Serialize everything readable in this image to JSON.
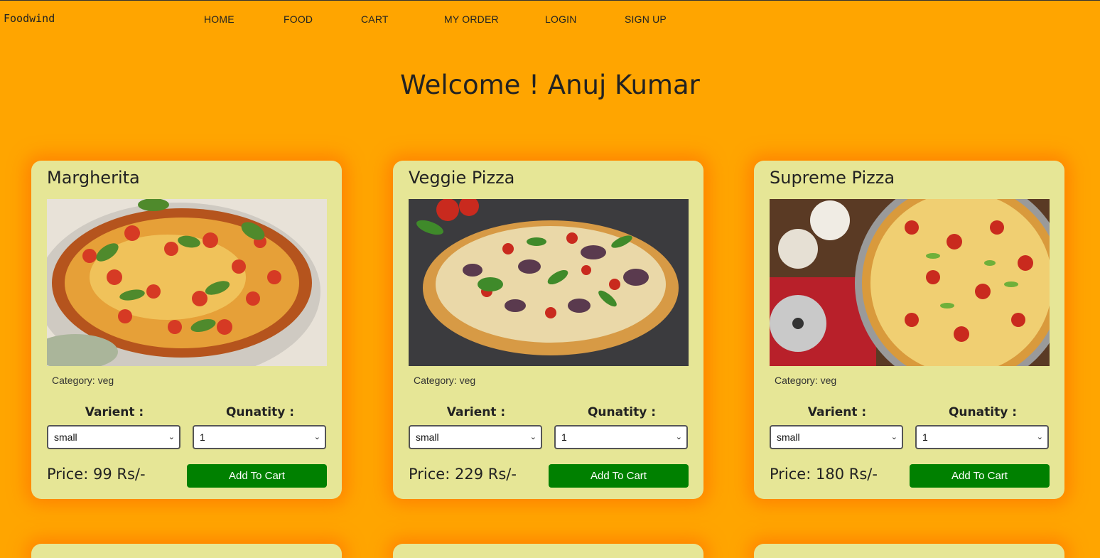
{
  "brand": "Foodwind",
  "nav": {
    "items": [
      {
        "label": "HOME"
      },
      {
        "label": "FOOD"
      },
      {
        "label": "CART"
      },
      {
        "label": "MY ORDER"
      },
      {
        "label": "LOGIN"
      },
      {
        "label": "SIGN UP"
      }
    ]
  },
  "welcome": "Welcome ! Anuj Kumar",
  "colors": {
    "page_bg": "#ffa500",
    "card_bg": "#e6e696",
    "button_bg": "#008000"
  },
  "cards": [
    {
      "title": "Margherita",
      "category": "Category: veg",
      "varient_label": "Varient :",
      "quantity_label": "Qunatity :",
      "varient_value": "small",
      "quantity_value": "1",
      "price": "Price: 99 Rs/-",
      "button": "Add To Cart"
    },
    {
      "title": "Veggie Pizza",
      "category": "Category: veg",
      "varient_label": "Varient :",
      "quantity_label": "Qunatity :",
      "varient_value": "small",
      "quantity_value": "1",
      "price": "Price: 229 Rs/-",
      "button": "Add To Cart"
    },
    {
      "title": "Supreme Pizza",
      "category": "Category: veg",
      "varient_label": "Varient :",
      "quantity_label": "Qunatity :",
      "varient_value": "small",
      "quantity_value": "1",
      "price": "Price: 180 Rs/-",
      "button": "Add To Cart"
    }
  ]
}
